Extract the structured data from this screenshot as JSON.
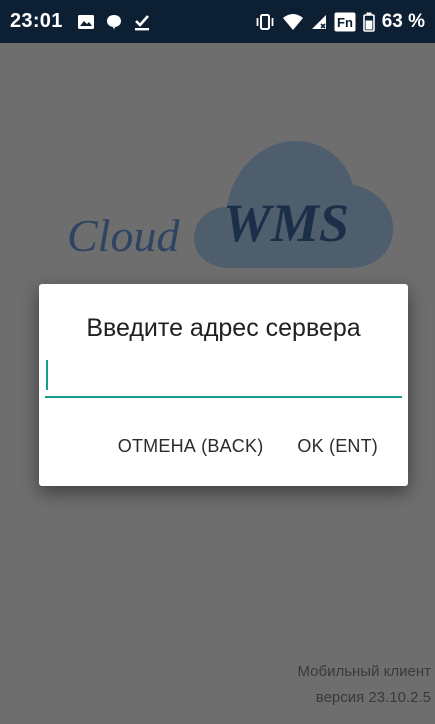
{
  "status_bar": {
    "time": "23:01",
    "battery_percent": "63 %",
    "icons": [
      "image-icon",
      "chat-bubble-icon",
      "download-done-icon",
      "vibrate-icon",
      "wifi-icon",
      "signal-icon",
      "fn-icon",
      "battery-icon"
    ],
    "fn_label": "Fn"
  },
  "logo": {
    "word1": "Cloud",
    "word2": "WMS"
  },
  "dialog": {
    "title": "Введите адрес сервера",
    "input_value": "",
    "input_placeholder": "",
    "cancel_label": "ОТМЕНА (BACK)",
    "ok_label": "OK (ENT)",
    "accent_color": "#169c8e"
  },
  "footer": {
    "client_label": "Мобильный клиент",
    "version_label": "версия 23.10.2.5"
  }
}
